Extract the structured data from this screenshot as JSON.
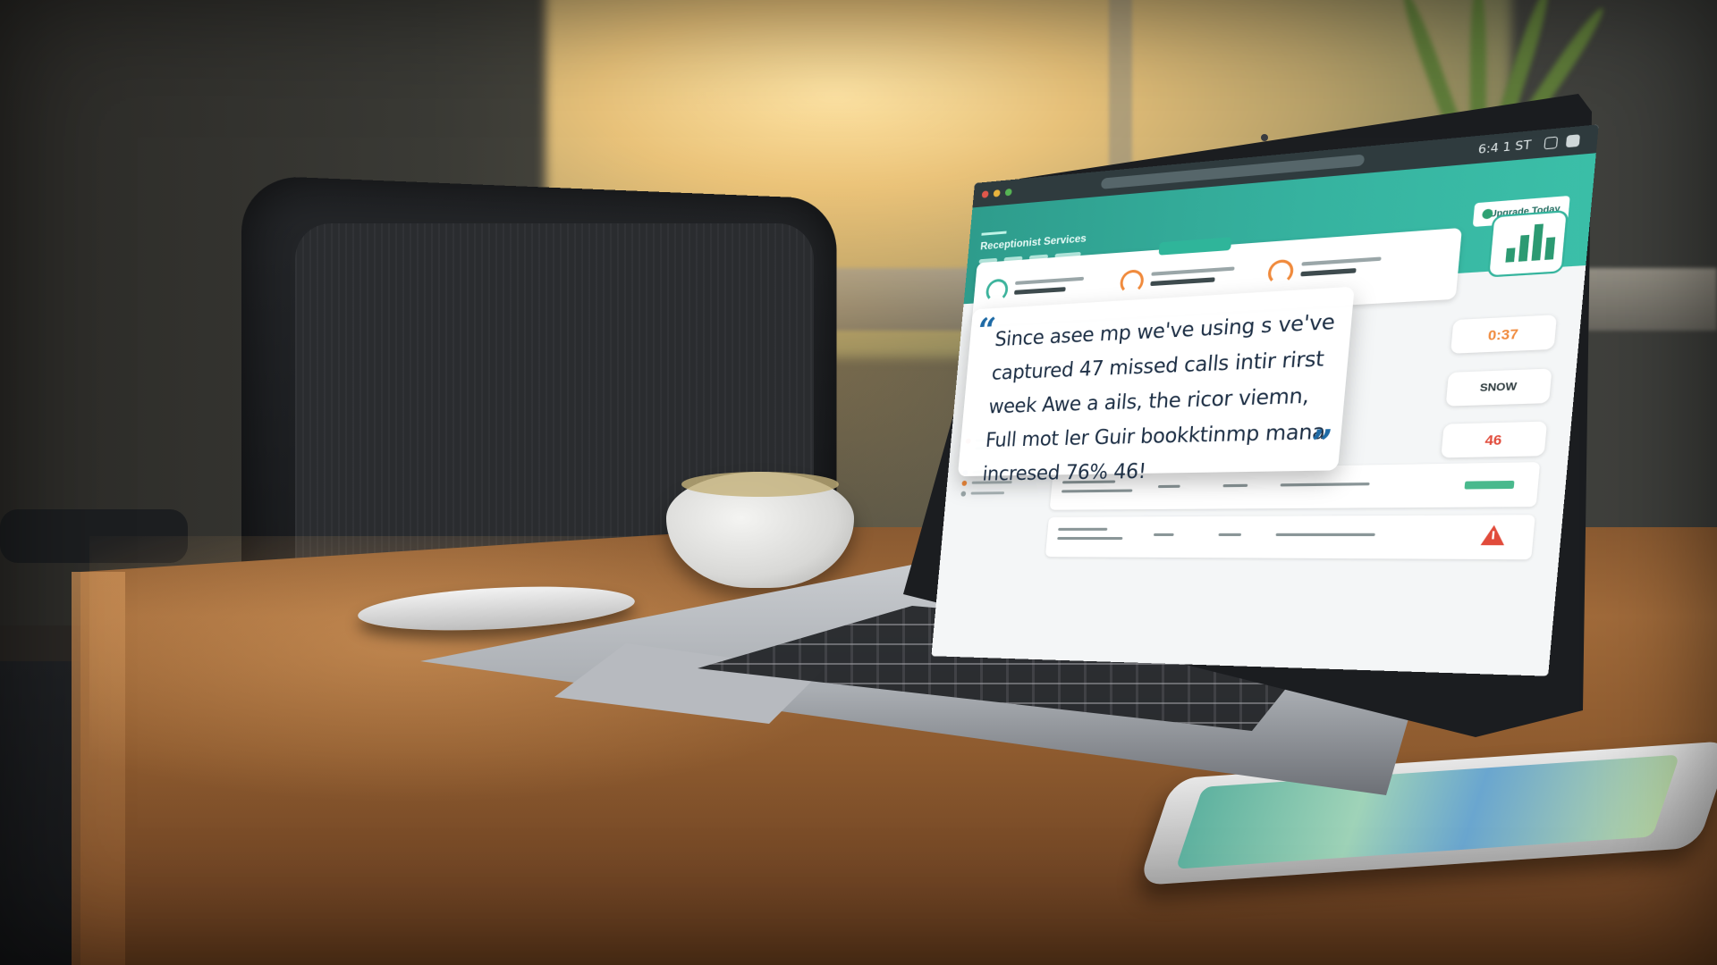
{
  "screen": {
    "titlebar_time": "6:4 1 ST",
    "app_title": "Receptionist Services",
    "upgrade_label": "Upgrade Today",
    "metrics": [
      "0:37",
      "SNOW",
      "46"
    ],
    "quote": {
      "text": "Since asee mp we've using s ve've captured 47 missed calls intir rirst week Awe a ails, the ricor viemn, Full mot ler Guir bookktinmp mana incresed 76% 46!",
      "open_mark": "“",
      "close_mark": "”"
    }
  },
  "colors": {
    "accent": "#36b3a0",
    "quote_text": "#1c2e44",
    "quote_marks": "#1e6aa5",
    "warning": "#e14b3b",
    "metric_orange": "#f08a3c"
  }
}
